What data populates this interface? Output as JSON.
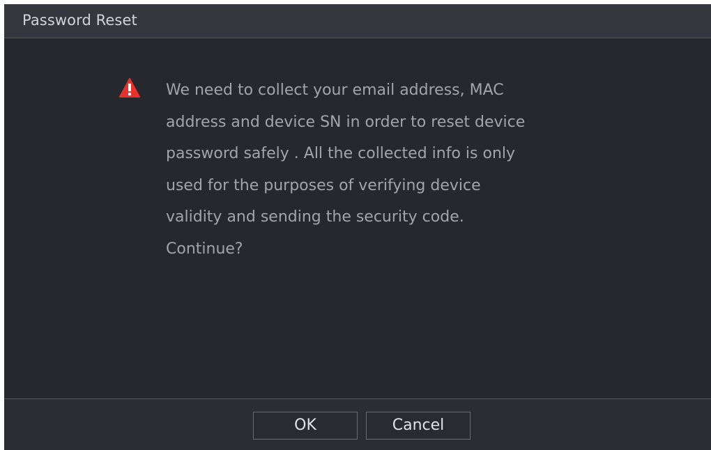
{
  "dialog": {
    "title": "Password Reset",
    "message": "We need to collect your email address, MAC\naddress and device SN in order to reset device\npassword safely . All the collected info is only\nused for the purposes of verifying device\nvalidity and sending the security code.\nContinue?",
    "icon": "warning-icon",
    "ok_label": "OK",
    "cancel_label": "Cancel"
  },
  "colors": {
    "background": "#27282e",
    "titlebar": "#36373e",
    "warning": "#e8312a"
  }
}
